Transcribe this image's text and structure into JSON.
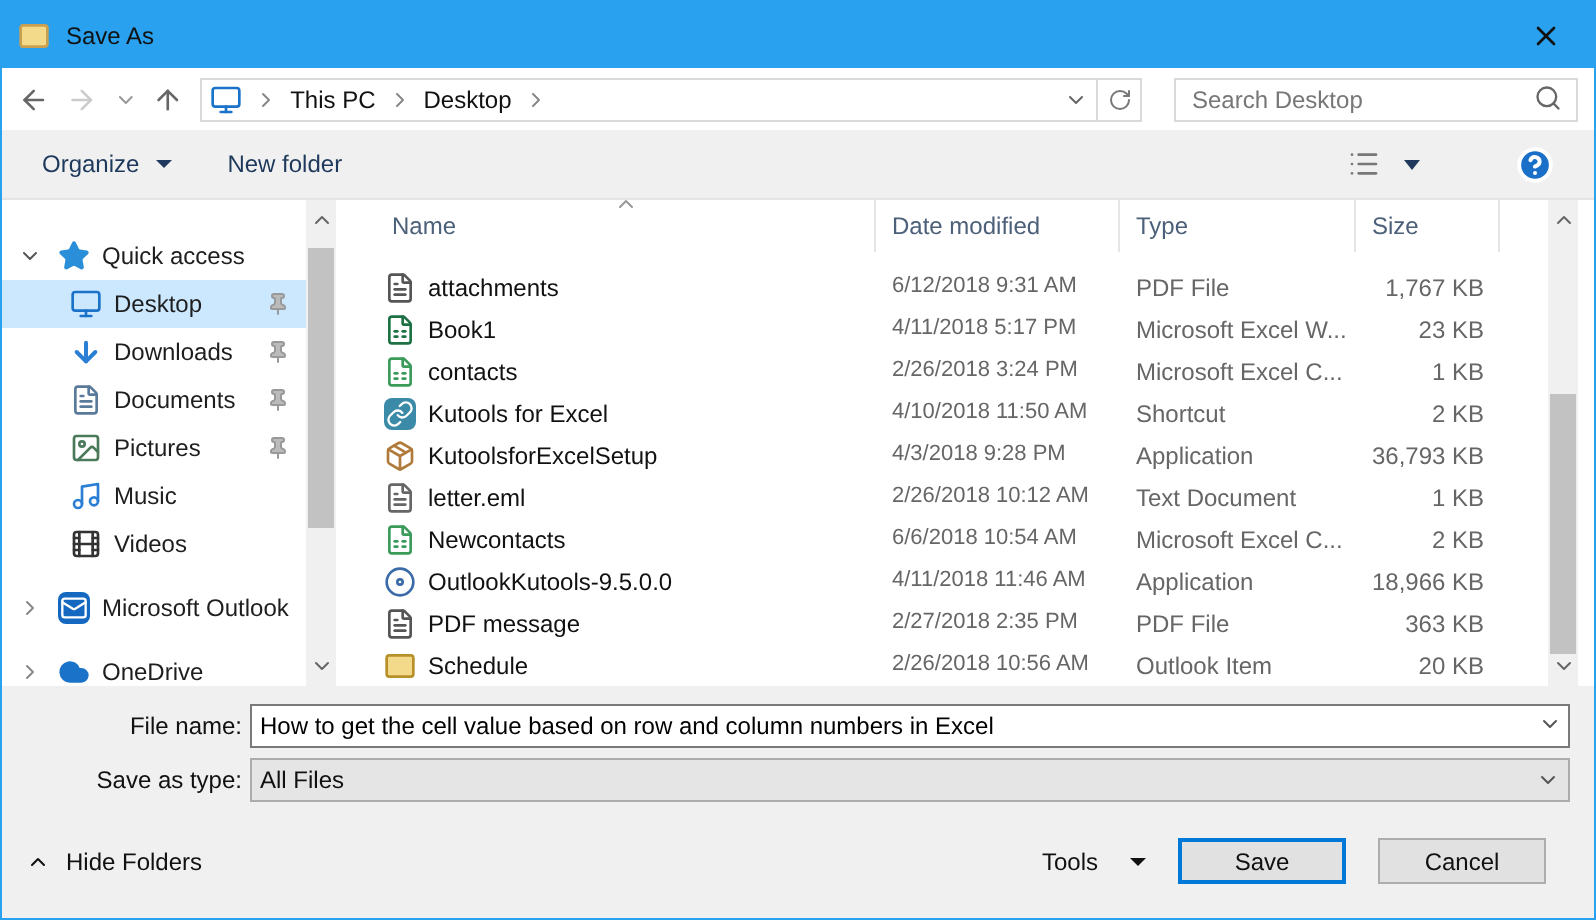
{
  "window": {
    "title": "Save As"
  },
  "breadcrumb": [
    "This PC",
    "Desktop"
  ],
  "search": {
    "placeholder": "Search Desktop"
  },
  "toolbar": {
    "organize": "Organize",
    "new_folder": "New folder"
  },
  "sidebar": {
    "items": [
      {
        "label": "Quick access",
        "kind": "star",
        "expanded": true,
        "children": [
          {
            "label": "Desktop",
            "kind": "desktop",
            "selected": true,
            "pinned": true
          },
          {
            "label": "Downloads",
            "kind": "download",
            "selected": false,
            "pinned": true
          },
          {
            "label": "Documents",
            "kind": "documents",
            "selected": false,
            "pinned": true
          },
          {
            "label": "Pictures",
            "kind": "pictures",
            "selected": false,
            "pinned": true
          },
          {
            "label": "Music",
            "kind": "music",
            "selected": false,
            "pinned": false
          },
          {
            "label": "Videos",
            "kind": "videos",
            "selected": false,
            "pinned": false
          }
        ]
      },
      {
        "label": "Microsoft Outlook",
        "kind": "outlook",
        "expanded": false
      },
      {
        "label": "OneDrive",
        "kind": "cloud",
        "expanded": false
      }
    ]
  },
  "table": {
    "columns": [
      {
        "label": "Name",
        "sorted": true
      },
      {
        "label": "Date modified",
        "sorted": false
      },
      {
        "label": "Type",
        "sorted": false
      },
      {
        "label": "Size",
        "sorted": false
      }
    ],
    "rows": [
      {
        "kind": "pdf",
        "name": "attachments",
        "date": "6/12/2018 9:31 AM",
        "type": "PDF File",
        "size": "1,767 KB"
      },
      {
        "kind": "excel",
        "name": "Book1",
        "date": "4/11/2018 5:17 PM",
        "type": "Microsoft Excel W...",
        "size": "23 KB"
      },
      {
        "kind": "csv",
        "name": "contacts",
        "date": "2/26/2018 3:24 PM",
        "type": "Microsoft Excel C...",
        "size": "1 KB"
      },
      {
        "kind": "shortcut",
        "name": "Kutools for Excel",
        "date": "4/10/2018 11:50 AM",
        "type": "Shortcut",
        "size": "2 KB"
      },
      {
        "kind": "package",
        "name": "KutoolsforExcelSetup",
        "date": "4/3/2018 9:28 PM",
        "type": "Application",
        "size": "36,793 KB"
      },
      {
        "kind": "text",
        "name": "letter.eml",
        "date": "2/26/2018 10:12 AM",
        "type": "Text Document",
        "size": "1 KB"
      },
      {
        "kind": "csv",
        "name": "Newcontacts",
        "date": "6/6/2018 10:54 AM",
        "type": "Microsoft Excel C...",
        "size": "2 KB"
      },
      {
        "kind": "installer",
        "name": "OutlookKutools-9.5.0.0",
        "date": "4/11/2018 11:46 AM",
        "type": "Application",
        "size": "18,966 KB"
      },
      {
        "kind": "pdf",
        "name": "PDF message",
        "date": "2/27/2018 2:35 PM",
        "type": "PDF File",
        "size": "363 KB"
      },
      {
        "kind": "mail",
        "name": "Schedule",
        "date": "2/26/2018 10:56 AM",
        "type": "Outlook Item",
        "size": "20 KB"
      }
    ]
  },
  "file_name": {
    "label": "File name:",
    "value": "How to get the cell value based on row and column numbers in Excel"
  },
  "save_type": {
    "label": "Save as type:",
    "value": "All Files"
  },
  "footer": {
    "hide_folders": "Hide Folders",
    "tools": "Tools",
    "save": "Save",
    "cancel": "Cancel"
  }
}
